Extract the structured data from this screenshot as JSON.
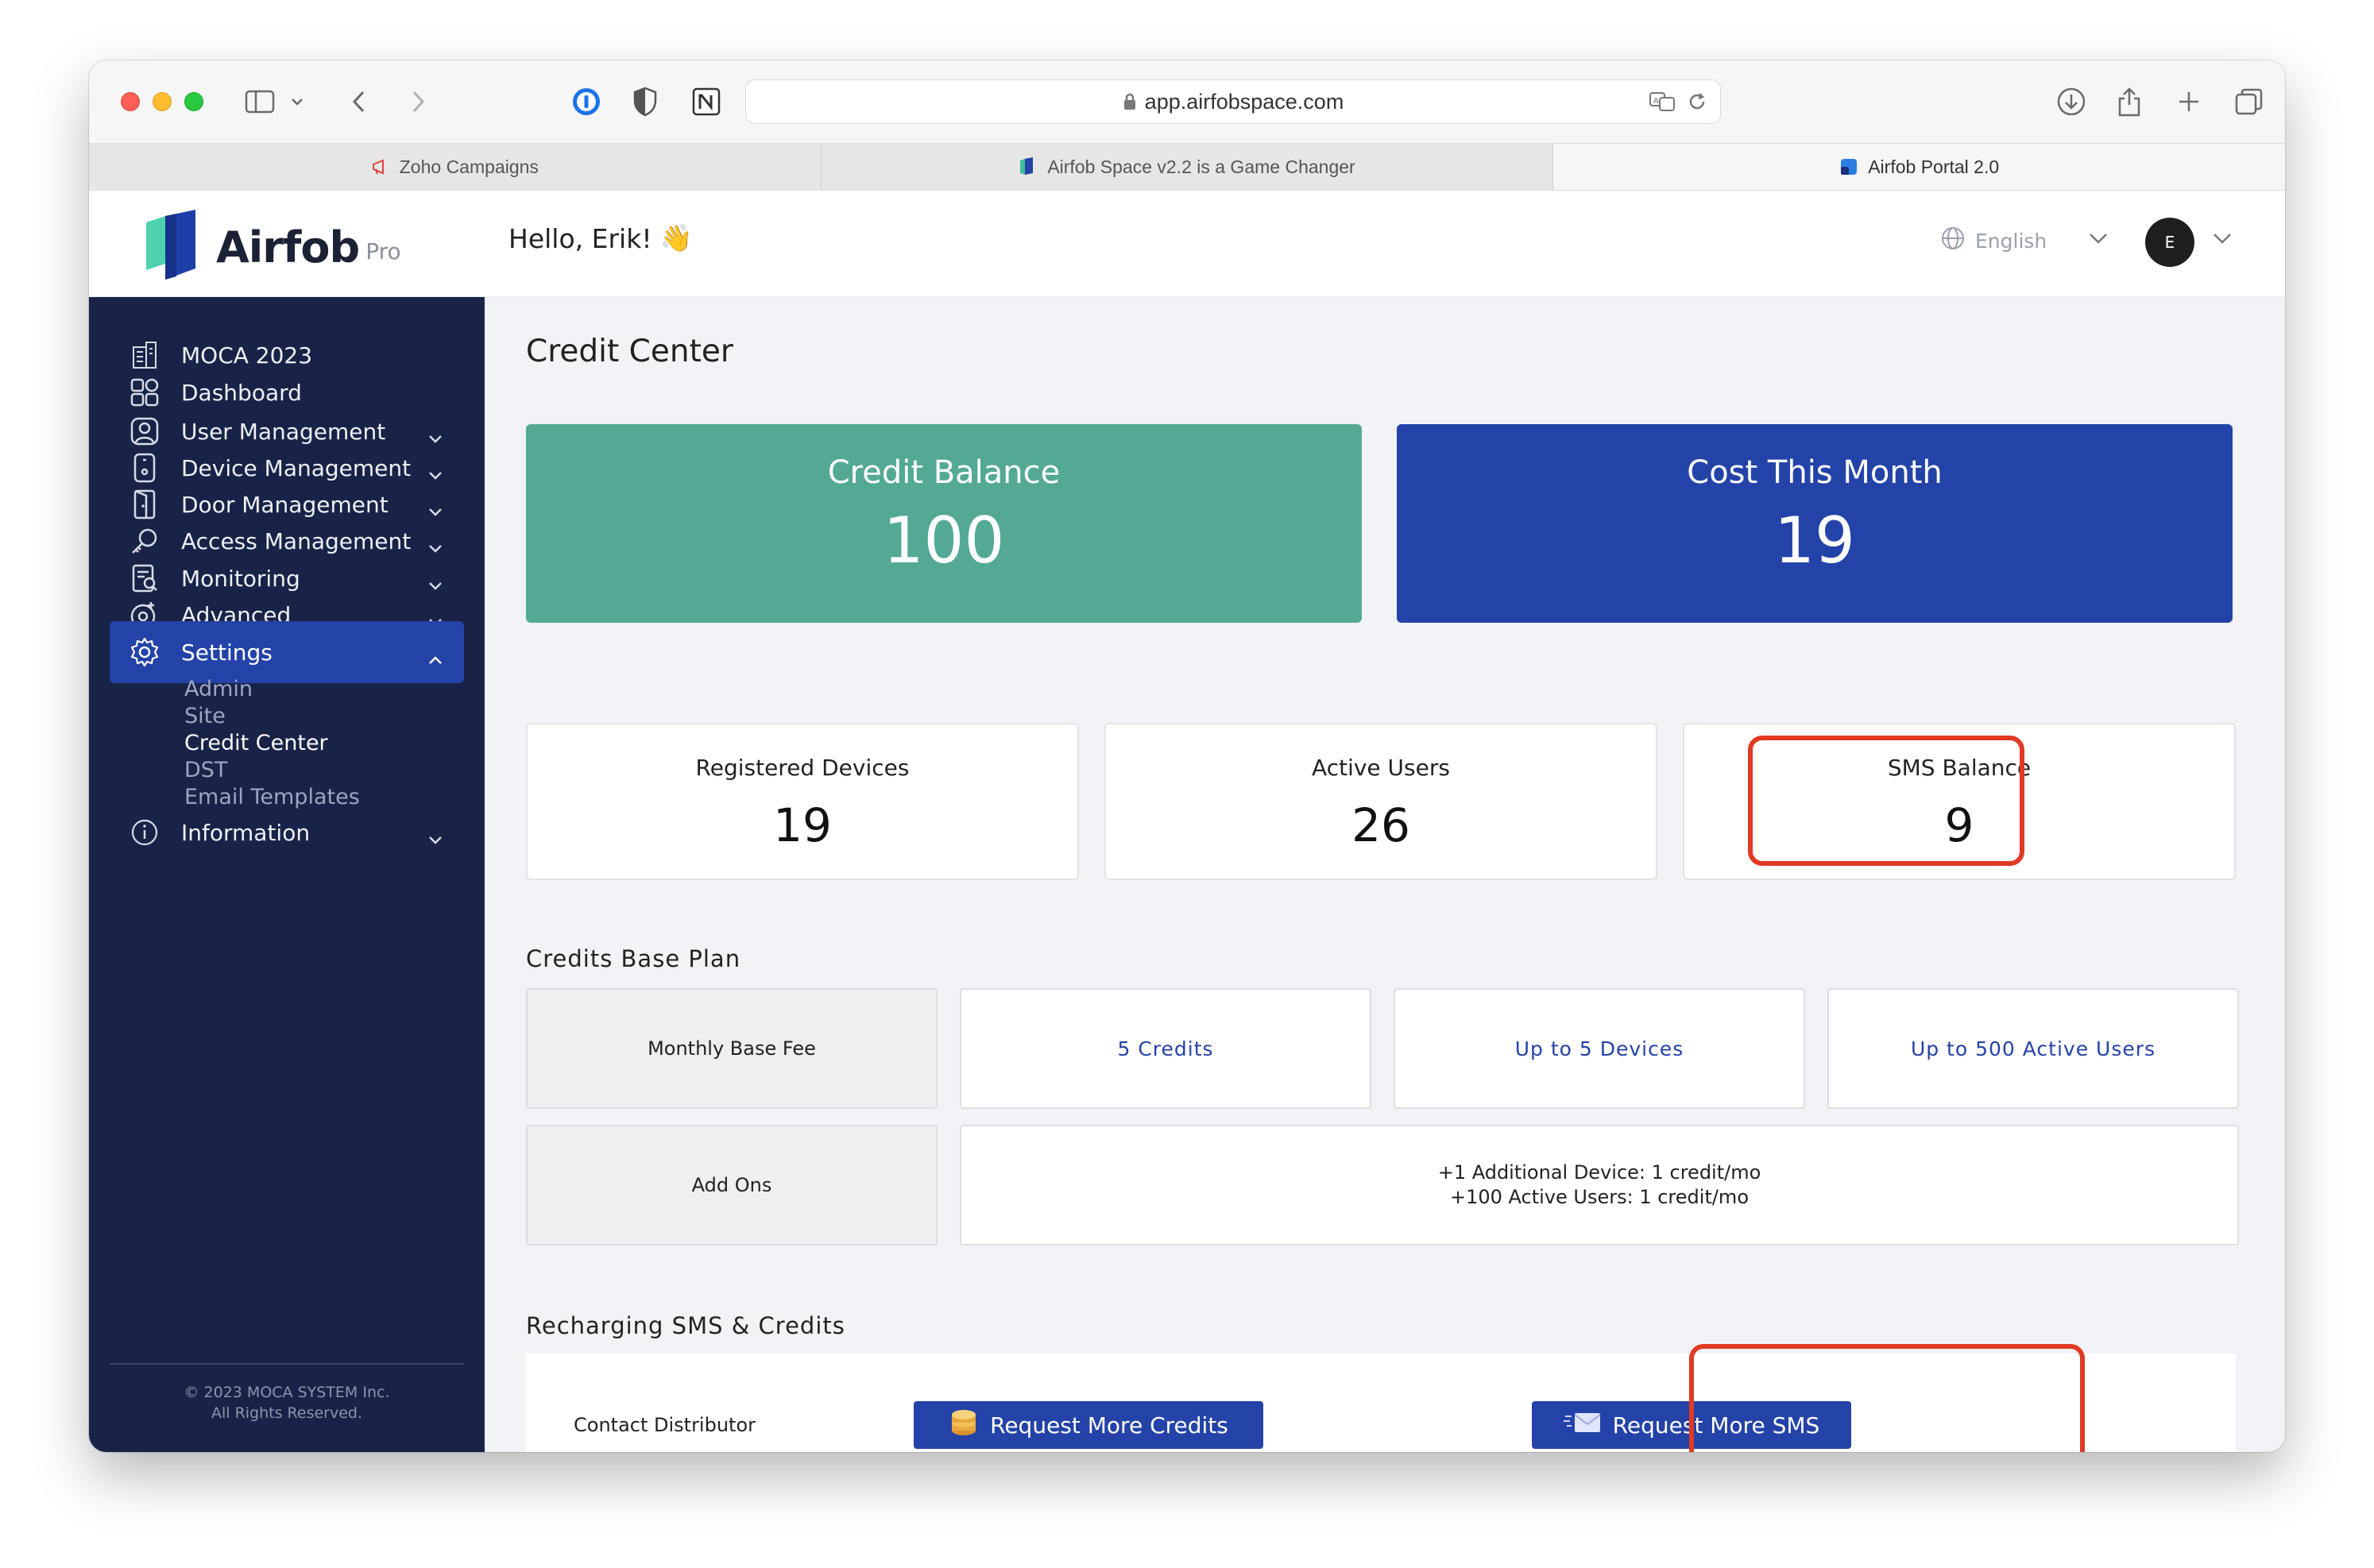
{
  "browser": {
    "url": "app.airfobspace.com",
    "tabs": [
      {
        "label": "Zoho Campaigns"
      },
      {
        "label": "Airfob Space v2.2 is a Game Changer"
      },
      {
        "label": "Airfob Portal 2.0"
      }
    ]
  },
  "header": {
    "logo_text": "Airfob",
    "logo_badge": "Pro",
    "greeting": "Hello, Erik!",
    "greeting_emoji": "👋",
    "language": "English",
    "avatar_initial": "E"
  },
  "sidebar": {
    "items": [
      {
        "label": "MOCA 2023",
        "icon": "building-icon"
      },
      {
        "label": "Dashboard",
        "icon": "grid-icon"
      },
      {
        "label": "User Management",
        "icon": "user-icon"
      },
      {
        "label": "Device Management",
        "icon": "device-icon"
      },
      {
        "label": "Door Management",
        "icon": "door-icon"
      },
      {
        "label": "Access Management",
        "icon": "key-icon"
      },
      {
        "label": "Monitoring",
        "icon": "monitoring-icon"
      },
      {
        "label": "Advanced",
        "icon": "advanced-icon"
      },
      {
        "label": "Settings",
        "icon": "gear-icon"
      },
      {
        "label": "Information",
        "icon": "info-icon"
      }
    ],
    "settings_sub": [
      {
        "label": "Admin"
      },
      {
        "label": "Site"
      },
      {
        "label": "Credit Center"
      },
      {
        "label": "DST"
      },
      {
        "label": "Email Templates"
      }
    ],
    "copyright_line1": "© 2023 MOCA SYSTEM Inc.",
    "copyright_line2": "All Rights Reserved."
  },
  "main": {
    "title": "Credit Center",
    "credit_balance": {
      "label": "Credit Balance",
      "value": "100"
    },
    "cost_this_month": {
      "label": "Cost This Month",
      "value": "19"
    },
    "stats": [
      {
        "label": "Registered Devices",
        "value": "19"
      },
      {
        "label": "Active Users",
        "value": "26"
      },
      {
        "label": "SMS Balance",
        "value": "9"
      }
    ],
    "base_plan": {
      "title": "Credits Base Plan",
      "monthly_label": "Monthly Base Fee",
      "features": [
        "5 Credits",
        "Up to 5 Devices",
        "Up to 500 Active Users"
      ],
      "addons_label": "Add Ons",
      "addon_lines": [
        "+1 Additional Device: 1 credit/mo",
        "+100 Active Users: 1 credit/mo"
      ]
    },
    "recharge": {
      "title": "Recharging SMS & Credits",
      "contact_label": "Contact Distributor",
      "request_credits": "Request More Credits",
      "request_sms": "Request More SMS"
    }
  },
  "colors": {
    "sidebar_bg": "#182347",
    "accent_blue": "#2443a8",
    "credit_green": "#53a994",
    "highlight_red": "#e03a24"
  }
}
